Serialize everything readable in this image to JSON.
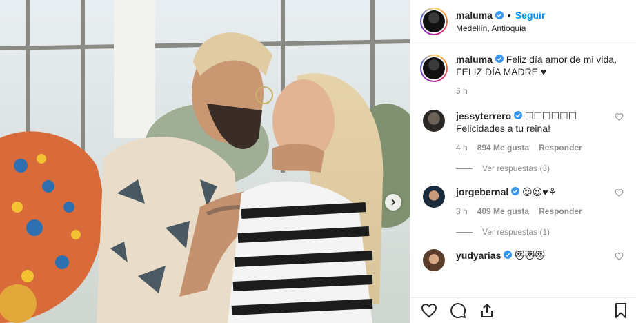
{
  "post": {
    "username": "maluma",
    "follow_label": "Seguir",
    "separator": "•",
    "location": "Medellín, Antioquia"
  },
  "caption": {
    "username": "maluma",
    "text": "Feliz día amor de mi vida, FELIZ DÍA MADRE ♥",
    "time": "5 h"
  },
  "comments": [
    {
      "username": "jessyterrero",
      "text": "☐☐☐☐☐☐ Felicidades a tu reina!",
      "time": "4 h",
      "likes": "894 Me gusta",
      "reply_label": "Responder",
      "view_replies": "Ver respuestas (3)"
    },
    {
      "username": "jorgebernal",
      "text": "😍😍♥⚘",
      "time": "3 h",
      "likes": "409 Me gusta",
      "reply_label": "Responder",
      "view_replies": "Ver respuestas (1)"
    },
    {
      "username": "yudyarias",
      "text": "😻😻😻"
    }
  ],
  "icons": {
    "verified": "verified-badge-icon",
    "like": "heart-icon",
    "comment": "comment-icon",
    "share": "share-icon",
    "save": "bookmark-icon",
    "next": "chevron-right-icon"
  },
  "colors": {
    "accent": "#0095f6",
    "secondary_text": "#8e8e8e",
    "border": "#efefef"
  }
}
